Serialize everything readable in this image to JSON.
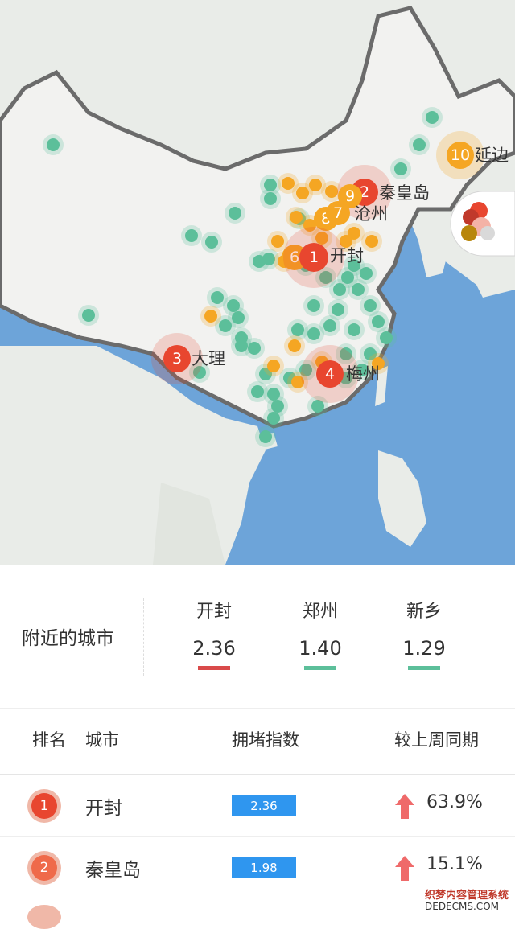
{
  "map": {
    "labels": {
      "yanbian": "延边",
      "qinhuangdao": "秦皇岛",
      "cangzhou": "沧州",
      "kaifeng": "开封",
      "dali": "大理",
      "meizhou": "梅州"
    },
    "numbers": [
      "10",
      "2",
      "9",
      "8",
      "7",
      "6",
      "1",
      "3",
      "4"
    ],
    "colors": {
      "sea": "#6da4d9",
      "land": "#f2f2f0",
      "foreign": "#e9ece8",
      "border": "#6b6b6b",
      "green": "#5cbf9a",
      "orange": "#f5a623",
      "red": "#e8462f"
    }
  },
  "nearby": {
    "title": "附近的城市",
    "cities": [
      {
        "name": "开封",
        "value": "2.36",
        "color": "#d94a4a"
      },
      {
        "name": "郑州",
        "value": "1.40",
        "color": "#5cbf9a"
      },
      {
        "name": "新乡",
        "value": "1.29",
        "color": "#5cbf9a"
      }
    ]
  },
  "table": {
    "headers": {
      "rank": "排名",
      "city": "城市",
      "index": "拥堵指数",
      "change": "较上周同期"
    },
    "rows": [
      {
        "rank": "1",
        "city": "开封",
        "index": "2.36",
        "change": "63.9%",
        "rank_color": "#e8462f"
      },
      {
        "rank": "2",
        "city": "秦皇岛",
        "index": "1.98",
        "change": "15.1%",
        "rank_color": "#ef6a4a"
      }
    ]
  },
  "watermark": {
    "line1": "织梦内容管理系统",
    "line2": "DEDECMS.COM"
  }
}
